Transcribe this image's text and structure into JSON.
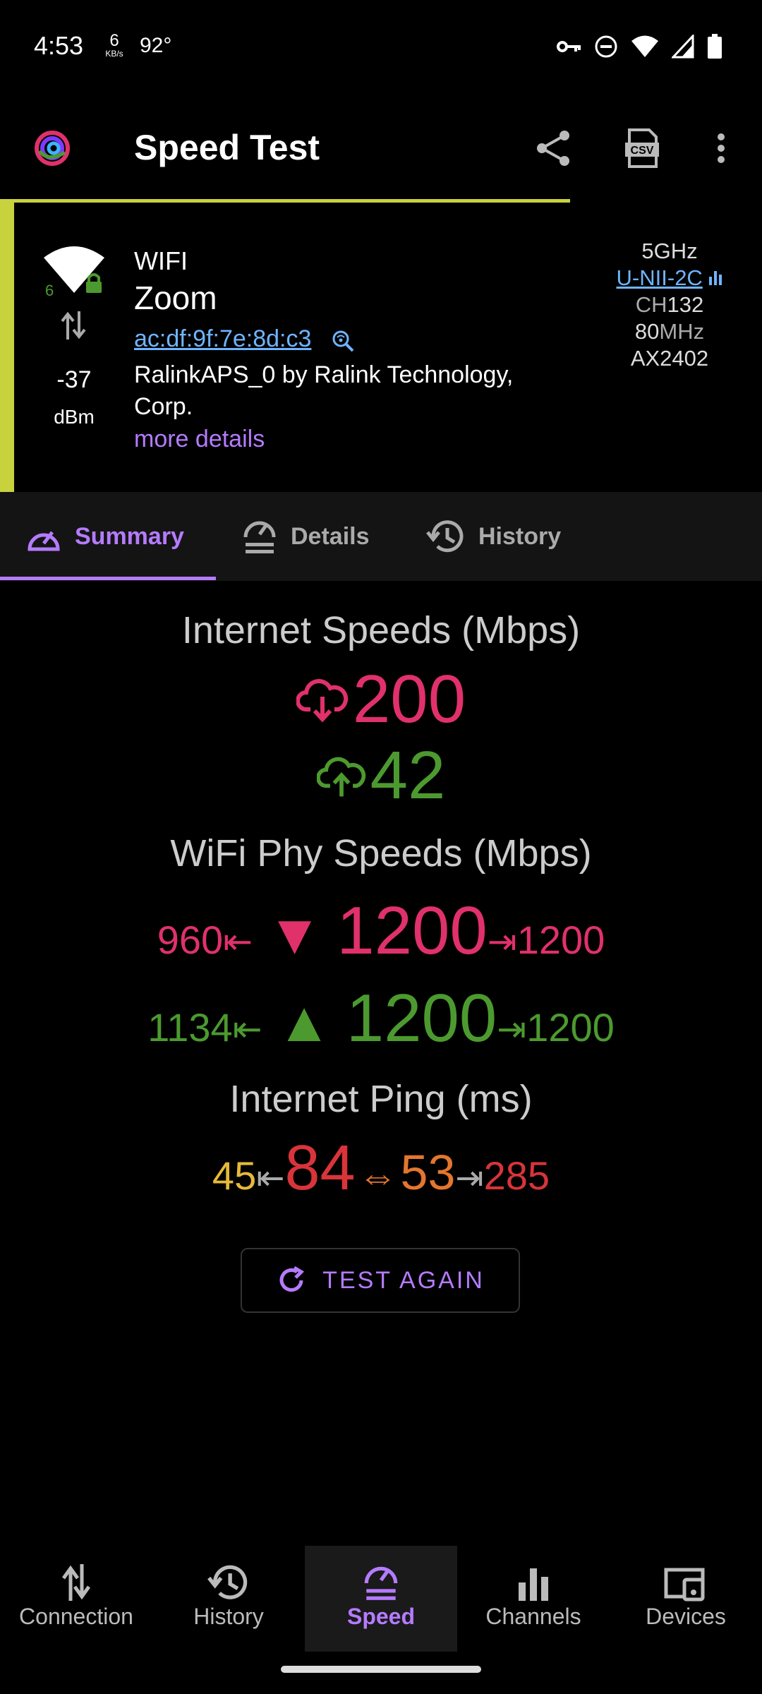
{
  "status_bar": {
    "time": "4:53",
    "kbs_value": "6",
    "kbs_unit": "KB/s",
    "temp": "92°"
  },
  "app_bar": {
    "title": "Speed Test"
  },
  "network": {
    "wifi_gen": "6",
    "type": "WIFI",
    "ssid": "Zoom",
    "bssid": "ac:df:9f:7e:8d:c3",
    "vendor": "RalinkAPS_0 by Ralink Technology, Corp.",
    "more": "more details",
    "rssi": "-37",
    "rssi_unit": "dBm",
    "freq": "5GHz",
    "band": "U-NII-2C",
    "ch_label": "CH",
    "ch": "132",
    "width_val": "80",
    "width_unit": "MHz",
    "model": "AX2402"
  },
  "tabs": [
    {
      "label": "Summary",
      "active": true
    },
    {
      "label": "Details",
      "active": false
    },
    {
      "label": "History",
      "active": false
    }
  ],
  "summary": {
    "internet_title": "Internet Speeds (Mbps)",
    "download": "200",
    "upload": "42",
    "phy_title": "WiFi Phy Speeds (Mbps)",
    "rx_min": "960",
    "rx": "1200",
    "rx_max": "1200",
    "tx_min": "1134",
    "tx": "1200",
    "tx_max": "1200",
    "ping_title": "Internet Ping (ms)",
    "ping_min": "45",
    "ping_now": "84",
    "ping_avg": "53",
    "ping_max": "285",
    "test_again": "TEST AGAIN"
  },
  "bottom_nav": [
    {
      "label": "Connection"
    },
    {
      "label": "History"
    },
    {
      "label": "Speed"
    },
    {
      "label": "Channels"
    },
    {
      "label": "Devices"
    }
  ],
  "colors": {
    "accent": "#b57bff",
    "download": "#e0316b",
    "upload": "#4c9a2f",
    "card_bar": "#c8d23c"
  }
}
